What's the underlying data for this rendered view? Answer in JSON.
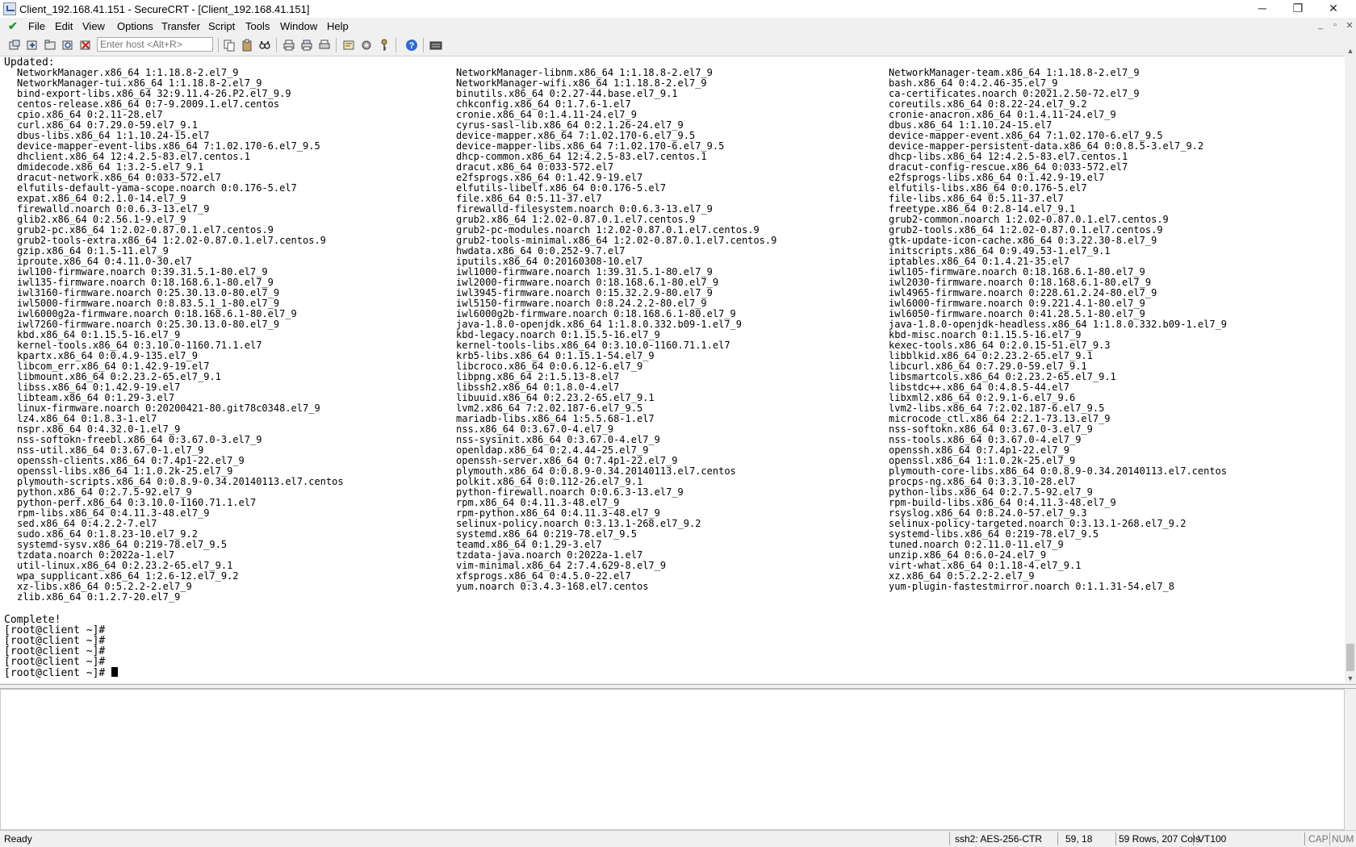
{
  "window": {
    "title": "Client_192.168.41.151 - SecureCRT - [Client_192.168.41.151]",
    "controls": {
      "minimize": "─",
      "maximize": "❐",
      "close": "✕"
    }
  },
  "menu": {
    "items": [
      "File",
      "Edit",
      "View",
      "Options",
      "Transfer",
      "Script",
      "Tools",
      "Window",
      "Help"
    ],
    "mdi": {
      "minimize": "_",
      "restore": "▫",
      "close": "✕"
    }
  },
  "toolbar": {
    "host_placeholder": "Enter host <Alt+R>"
  },
  "terminal": {
    "header": "Updated:",
    "columns": [
      [
        "NetworkManager.x86_64 1:1.18.8-2.el7_9",
        "NetworkManager-tui.x86_64 1:1.18.8-2.el7_9",
        "bind-export-libs.x86_64 32:9.11.4-26.P2.el7_9.9",
        "centos-release.x86_64 0:7-9.2009.1.el7.centos",
        "cpio.x86_64 0:2.11-28.el7",
        "curl.x86_64 0:7.29.0-59.el7_9.1",
        "dbus-libs.x86_64 1:1.10.24-15.el7",
        "device-mapper-event-libs.x86_64 7:1.02.170-6.el7_9.5",
        "dhclient.x86_64 12:4.2.5-83.el7.centos.1",
        "dmidecode.x86_64 1:3.2-5.el7_9.1",
        "dracut-network.x86_64 0:033-572.el7",
        "elfutils-default-yama-scope.noarch 0:0.176-5.el7",
        "expat.x86_64 0:2.1.0-14.el7_9",
        "firewalld.noarch 0:0.6.3-13.el7_9",
        "glib2.x86_64 0:2.56.1-9.el7_9",
        "grub2-pc.x86_64 1:2.02-0.87.0.1.el7.centos.9",
        "grub2-tools-extra.x86_64 1:2.02-0.87.0.1.el7.centos.9",
        "gzip.x86_64 0:1.5-11.el7_9",
        "iproute.x86_64 0:4.11.0-30.el7",
        "iwl100-firmware.noarch 0:39.31.5.1-80.el7_9",
        "iwl135-firmware.noarch 0:18.168.6.1-80.el7_9",
        "iwl3160-firmware.noarch 0:25.30.13.0-80.el7_9",
        "iwl5000-firmware.noarch 0:8.83.5.1_1-80.el7_9",
        "iwl6000g2a-firmware.noarch 0:18.168.6.1-80.el7_9",
        "iwl7260-firmware.noarch 0:25.30.13.0-80.el7_9",
        "kbd.x86_64 0:1.15.5-16.el7_9",
        "kernel-tools.x86_64 0:3.10.0-1160.71.1.el7",
        "kpartx.x86_64 0:0.4.9-135.el7_9",
        "libcom_err.x86_64 0:1.42.9-19.el7",
        "libmount.x86_64 0:2.23.2-65.el7_9.1",
        "libss.x86_64 0:1.42.9-19.el7",
        "libteam.x86_64 0:1.29-3.el7",
        "linux-firmware.noarch 0:20200421-80.git78c0348.el7_9",
        "lz4.x86_64 0:1.8.3-1.el7",
        "nspr.x86_64 0:4.32.0-1.el7_9",
        "nss-softokn-freebl.x86_64 0:3.67.0-3.el7_9",
        "nss-util.x86_64 0:3.67.0-1.el7_9",
        "openssh-clients.x86_64 0:7.4p1-22.el7_9",
        "openssl-libs.x86_64 1:1.0.2k-25.el7_9",
        "plymouth-scripts.x86_64 0:0.8.9-0.34.20140113.el7.centos",
        "python.x86_64 0:2.7.5-92.el7_9",
        "python-perf.x86_64 0:3.10.0-1160.71.1.el7",
        "rpm-libs.x86_64 0:4.11.3-48.el7_9",
        "sed.x86_64 0:4.2.2-7.el7",
        "sudo.x86_64 0:1.8.23-10.el7_9.2",
        "systemd-sysv.x86_64 0:219-78.el7_9.5",
        "tzdata.noarch 0:2022a-1.el7",
        "util-linux.x86_64 0:2.23.2-65.el7_9.1",
        "wpa_supplicant.x86_64 1:2.6-12.el7_9.2",
        "xz-libs.x86_64 0:5.2.2-2.el7_9",
        "zlib.x86_64 0:1.2.7-20.el7_9"
      ],
      [
        "NetworkManager-libnm.x86_64 1:1.18.8-2.el7_9",
        "NetworkManager-wifi.x86_64 1:1.18.8-2.el7_9",
        "binutils.x86_64 0:2.27-44.base.el7_9.1",
        "chkconfig.x86_64 0:1.7.6-1.el7",
        "cronie.x86_64 0:1.4.11-24.el7_9",
        "cyrus-sasl-lib.x86_64 0:2.1.26-24.el7_9",
        "device-mapper.x86_64 7:1.02.170-6.el7_9.5",
        "device-mapper-libs.x86_64 7:1.02.170-6.el7_9.5",
        "dhcp-common.x86_64 12:4.2.5-83.el7.centos.1",
        "dracut.x86_64 0:033-572.el7",
        "e2fsprogs.x86_64 0:1.42.9-19.el7",
        "elfutils-libelf.x86_64 0:0.176-5.el7",
        "file.x86_64 0:5.11-37.el7",
        "firewalld-filesystem.noarch 0:0.6.3-13.el7_9",
        "grub2.x86_64 1:2.02-0.87.0.1.el7.centos.9",
        "grub2-pc-modules.noarch 1:2.02-0.87.0.1.el7.centos.9",
        "grub2-tools-minimal.x86_64 1:2.02-0.87.0.1.el7.centos.9",
        "hwdata.x86_64 0:0.252-9.7.el7",
        "iputils.x86_64 0:20160308-10.el7",
        "iwl1000-firmware.noarch 1:39.31.5.1-80.el7_9",
        "iwl2000-firmware.noarch 0:18.168.6.1-80.el7_9",
        "iwl3945-firmware.noarch 0:15.32.2.9-80.el7_9",
        "iwl5150-firmware.noarch 0:8.24.2.2-80.el7_9",
        "iwl6000g2b-firmware.noarch 0:18.168.6.1-80.el7_9",
        "java-1.8.0-openjdk.x86_64 1:1.8.0.332.b09-1.el7_9",
        "kbd-legacy.noarch 0:1.15.5-16.el7_9",
        "kernel-tools-libs.x86_64 0:3.10.0-1160.71.1.el7",
        "krb5-libs.x86_64 0:1.15.1-54.el7_9",
        "libcroco.x86_64 0:0.6.12-6.el7_9",
        "libpng.x86_64 2:1.5.13-8.el7",
        "libssh2.x86_64 0:1.8.0-4.el7",
        "libuuid.x86_64 0:2.23.2-65.el7_9.1",
        "lvm2.x86_64 7:2.02.187-6.el7_9.5",
        "mariadb-libs.x86_64 1:5.5.68-1.el7",
        "nss.x86_64 0:3.67.0-4.el7_9",
        "nss-sysinit.x86_64 0:3.67.0-4.el7_9",
        "openldap.x86_64 0:2.4.44-25.el7_9",
        "openssh-server.x86_64 0:7.4p1-22.el7_9",
        "plymouth.x86_64 0:0.8.9-0.34.20140113.el7.centos",
        "polkit.x86_64 0:0.112-26.el7_9.1",
        "python-firewall.noarch 0:0.6.3-13.el7_9",
        "rpm.x86_64 0:4.11.3-48.el7_9",
        "rpm-python.x86_64 0:4.11.3-48.el7_9",
        "selinux-policy.noarch 0:3.13.1-268.el7_9.2",
        "systemd.x86_64 0:219-78.el7_9.5",
        "teamd.x86_64 0:1.29-3.el7",
        "tzdata-java.noarch 0:2022a-1.el7",
        "vim-minimal.x86_64 2:7.4.629-8.el7_9",
        "xfsprogs.x86_64 0:4.5.0-22.el7",
        "yum.noarch 0:3.4.3-168.el7.centos"
      ],
      [
        "NetworkManager-team.x86_64 1:1.18.8-2.el7_9",
        "bash.x86_64 0:4.2.46-35.el7_9",
        "ca-certificates.noarch 0:2021.2.50-72.el7_9",
        "coreutils.x86_64 0:8.22-24.el7_9.2",
        "cronie-anacron.x86_64 0:1.4.11-24.el7_9",
        "dbus.x86_64 1:1.10.24-15.el7",
        "device-mapper-event.x86_64 7:1.02.170-6.el7_9.5",
        "device-mapper-persistent-data.x86_64 0:0.8.5-3.el7_9.2",
        "dhcp-libs.x86_64 12:4.2.5-83.el7.centos.1",
        "dracut-config-rescue.x86_64 0:033-572.el7",
        "e2fsprogs-libs.x86_64 0:1.42.9-19.el7",
        "elfutils-libs.x86_64 0:0.176-5.el7",
        "file-libs.x86_64 0:5.11-37.el7",
        "freetype.x86_64 0:2.8-14.el7_9.1",
        "grub2-common.noarch 1:2.02-0.87.0.1.el7.centos.9",
        "grub2-tools.x86_64 1:2.02-0.87.0.1.el7.centos.9",
        "gtk-update-icon-cache.x86_64 0:3.22.30-8.el7_9",
        "initscripts.x86_64 0:9.49.53-1.el7_9.1",
        "iptables.x86_64 0:1.4.21-35.el7",
        "iwl105-firmware.noarch 0:18.168.6.1-80.el7_9",
        "iwl2030-firmware.noarch 0:18.168.6.1-80.el7_9",
        "iwl4965-firmware.noarch 0:228.61.2.24-80.el7_9",
        "iwl6000-firmware.noarch 0:9.221.4.1-80.el7_9",
        "iwl6050-firmware.noarch 0:41.28.5.1-80.el7_9",
        "java-1.8.0-openjdk-headless.x86_64 1:1.8.0.332.b09-1.el7_9",
        "kbd-misc.noarch 0:1.15.5-16.el7_9",
        "kexec-tools.x86_64 0:2.0.15-51.el7_9.3",
        "libblkid.x86_64 0:2.23.2-65.el7_9.1",
        "libcurl.x86_64 0:7.29.0-59.el7_9.1",
        "libsmartcols.x86_64 0:2.23.2-65.el7_9.1",
        "libstdc++.x86_64 0:4.8.5-44.el7",
        "libxml2.x86_64 0:2.9.1-6.el7_9.6",
        "lvm2-libs.x86_64 7:2.02.187-6.el7_9.5",
        "microcode_ctl.x86_64 2:2.1-73.13.el7_9",
        "nss-softokn.x86_64 0:3.67.0-3.el7_9",
        "nss-tools.x86_64 0:3.67.0-4.el7_9",
        "openssh.x86_64 0:7.4p1-22.el7_9",
        "openssl.x86_64 1:1.0.2k-25.el7_9",
        "plymouth-core-libs.x86_64 0:0.8.9-0.34.20140113.el7.centos",
        "procps-ng.x86_64 0:3.3.10-28.el7",
        "python-libs.x86_64 0:2.7.5-92.el7_9",
        "rpm-build-libs.x86_64 0:4.11.3-48.el7_9",
        "rsyslog.x86_64 0:8.24.0-57.el7_9.3",
        "selinux-policy-targeted.noarch 0:3.13.1-268.el7_9.2",
        "systemd-libs.x86_64 0:219-78.el7_9.5",
        "tuned.noarch 0:2.11.0-11.el7_9",
        "unzip.x86_64 0:6.0-24.el7_9",
        "virt-what.x86_64 0:1.18-4.el7_9.1",
        "xz.x86_64 0:5.2.2-2.el7_9",
        "yum-plugin-fastestmirror.noarch 0:1.1.31-54.el7_8"
      ]
    ],
    "complete": "Complete!",
    "prompts": [
      "[root@client ~]#",
      "[root@client ~]#",
      "[root@client ~]#",
      "[root@client ~]#",
      "[root@client ~]# "
    ]
  },
  "statusbar": {
    "ready": "Ready",
    "cipher": "ssh2: AES-256-CTR",
    "position": "59,  18",
    "dims": "59 Rows, 207 Cols",
    "term_type": "VT100",
    "cap": "CAP",
    "num": "NUM"
  }
}
